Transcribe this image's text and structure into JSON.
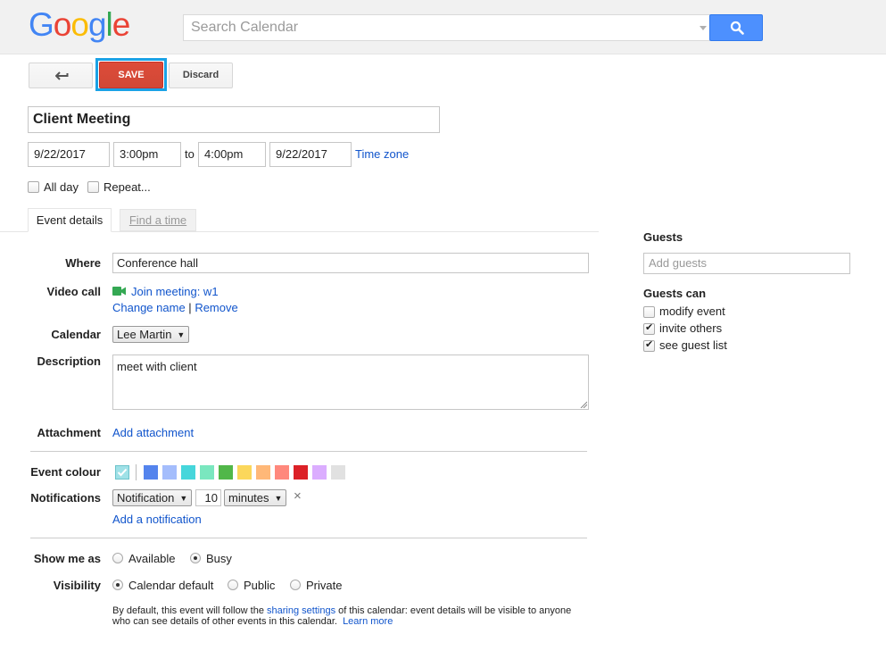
{
  "header": {
    "logo_letters": [
      "G",
      "o",
      "o",
      "g",
      "l",
      "e"
    ],
    "search_placeholder": "Search Calendar"
  },
  "toolbar": {
    "save_label": "SAVE",
    "discard_label": "Discard"
  },
  "event": {
    "title": "Client Meeting",
    "start_date": "9/22/2017",
    "start_time": "3:00pm",
    "to_label": "to",
    "end_time": "4:00pm",
    "end_date": "9/22/2017",
    "time_zone_link": "Time zone",
    "all_day_label": "All day",
    "all_day_checked": false,
    "repeat_label": "Repeat...",
    "repeat_checked": false
  },
  "tabs": [
    {
      "label": "Event details",
      "active": true
    },
    {
      "label": "Find a time",
      "active": false
    }
  ],
  "details": {
    "where_label": "Where",
    "where_value": "Conference hall",
    "video_call_label": "Video call",
    "join_meeting": "Join meeting: w1",
    "change_name": "Change name",
    "separator": "|",
    "remove": "Remove",
    "calendar_label": "Calendar",
    "calendar_value": "Lee Martin",
    "description_label": "Description",
    "description_value": "meet with client",
    "attachment_label": "Attachment",
    "add_attachment": "Add attachment",
    "event_colour_label": "Event colour",
    "colours": [
      "#5484ed",
      "#a4bdfc",
      "#46d6db",
      "#7ae7bf",
      "#51b749",
      "#fbd75b",
      "#ffb878",
      "#ff887c",
      "#dc2127",
      "#dbadff",
      "#e1e1e1"
    ],
    "default_colour": "#9fe1e7",
    "notifications_label": "Notifications",
    "notification_type": "Notification",
    "notification_amount": "10",
    "notification_unit": "minutes",
    "remove_notification_glyph": "×",
    "add_notification": "Add a notification",
    "show_me_as_label": "Show me as",
    "available_label": "Available",
    "busy_label": "Busy",
    "show_me_as_selected": "Busy",
    "visibility_label": "Visibility",
    "calendar_default_label": "Calendar default",
    "public_label": "Public",
    "private_label": "Private",
    "visibility_selected": "Calendar default",
    "footnote_part1": "By default, this event will follow the ",
    "footnote_link": "sharing settings",
    "footnote_part2": " of this calendar: event details will be visible to anyone",
    "footnote_line2": "who can see details of other events in this calendar.",
    "learn_more": "Learn more"
  },
  "guests": {
    "heading": "Guests",
    "add_placeholder": "Add guests",
    "guests_can_heading": "Guests can",
    "options": [
      {
        "label": "modify event",
        "checked": false
      },
      {
        "label": "invite others",
        "checked": true
      },
      {
        "label": "see guest list",
        "checked": true
      }
    ]
  },
  "colors": {
    "save_red": "#d14836",
    "search_blue": "#4d90fe",
    "link_blue": "#1155cc",
    "highlight_cyan": "#1aa2e6"
  }
}
